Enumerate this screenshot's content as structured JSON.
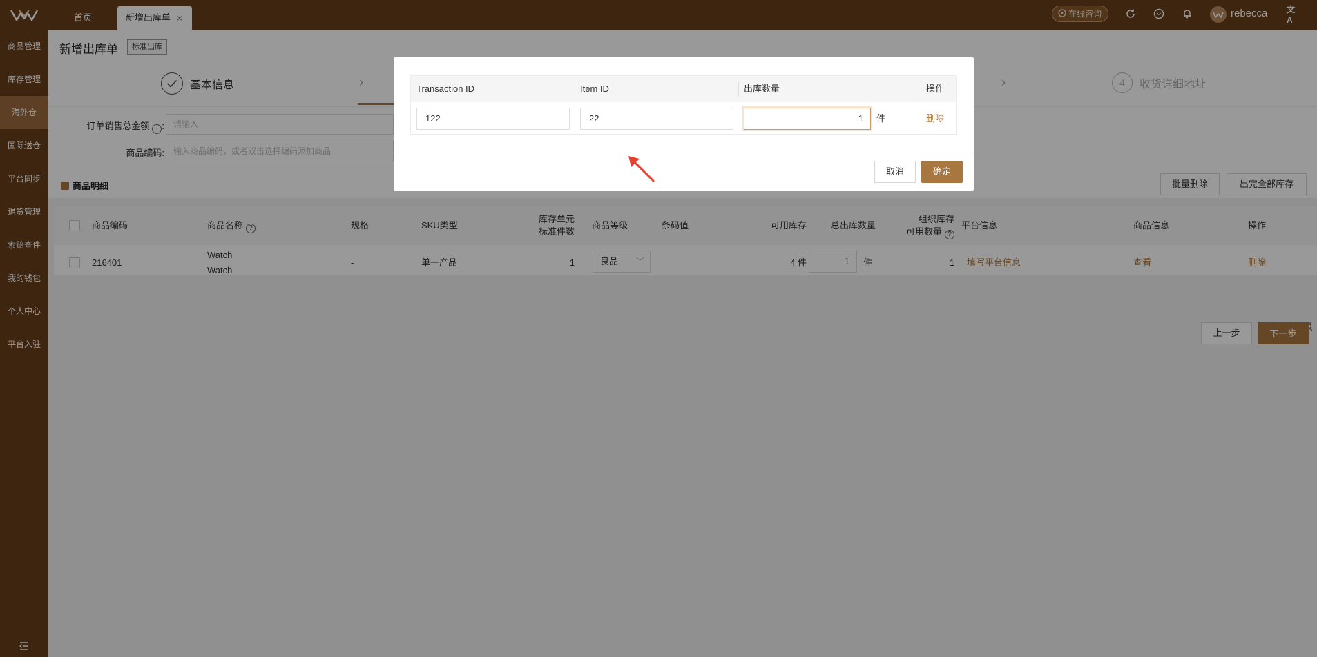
{
  "colors": {
    "brand": "#673f1a",
    "accent": "#a8763f",
    "active_menu": "#9c6a3e"
  },
  "topbar": {
    "logo_icon": "w-logo-icon",
    "tabs": [
      {
        "label": "首页"
      },
      {
        "label": "新增出库单",
        "close": "×"
      }
    ],
    "consult_label": "在线咨询",
    "icons": [
      "refresh-icon",
      "heart-shield-icon",
      "bell-icon",
      "translate-icon"
    ],
    "username": "rebecca",
    "translate_glyph": "文A"
  },
  "sidebar": {
    "items": [
      {
        "label": "商品管理"
      },
      {
        "label": "库存管理"
      },
      {
        "label": "海外仓"
      },
      {
        "label": "国际送仓"
      },
      {
        "label": "平台同步"
      },
      {
        "label": "退货管理"
      },
      {
        "label": "索赔查件"
      },
      {
        "label": "我的钱包"
      },
      {
        "label": "个人中心"
      },
      {
        "label": "平台入驻"
      }
    ],
    "active_label": "海外仓"
  },
  "page": {
    "title": "新增出库单",
    "badge": "标准出库",
    "steps": [
      {
        "label": "基本信息",
        "state": "done"
      },
      {
        "label": "收货详细地址",
        "number": "4",
        "state": "pending"
      }
    ]
  },
  "form": {
    "order_total_label": "订单销售总金额",
    "order_total_suffix": ":",
    "order_total_placeholder": "请输入",
    "product_code_label": "商品编码:",
    "product_code_placeholder": "输入商品编码，或者双击选择编码添加商品"
  },
  "detail": {
    "title": "商品明细",
    "batch_delete": "批量删除",
    "ship_all": "出完全部库存"
  },
  "table": {
    "headers": {
      "code": "商品编码",
      "name": "商品名称",
      "spec": "规格",
      "sku_type": "SKU类型",
      "unit_std_1": "库存单元",
      "unit_std_2": "标准件数",
      "grade": "商品等级",
      "barcode": "条码值",
      "available": "可用库存",
      "total_out": "总出库数量",
      "org_stock_1": "组织库存",
      "org_stock_2": "可用数量",
      "platform_info": "平台信息",
      "product_info": "商品信息",
      "action": "操作"
    },
    "rows": [
      {
        "code": "216401",
        "name_1": "Watch",
        "name_2": "Watch",
        "spec": "-",
        "sku_type": "单一产品",
        "unit_std": "1",
        "grade": "良品",
        "available": "4 件",
        "qty": "1",
        "unit": "件",
        "org_stock": "1",
        "platform_link": "填写平台信息",
        "product_link": "查看",
        "action": "删除"
      }
    ],
    "total": "共 1 条记录"
  },
  "nav": {
    "prev": "上一步",
    "next": "下一步"
  },
  "modal": {
    "headers": {
      "transaction_id": "Transaction ID",
      "item_id": "Item ID",
      "qty": "出库数量",
      "action": "操作"
    },
    "row": {
      "transaction_id": "122",
      "item_id": "22",
      "qty": "1",
      "unit": "件",
      "delete": "删除"
    },
    "cancel": "取消",
    "confirm": "确定"
  }
}
